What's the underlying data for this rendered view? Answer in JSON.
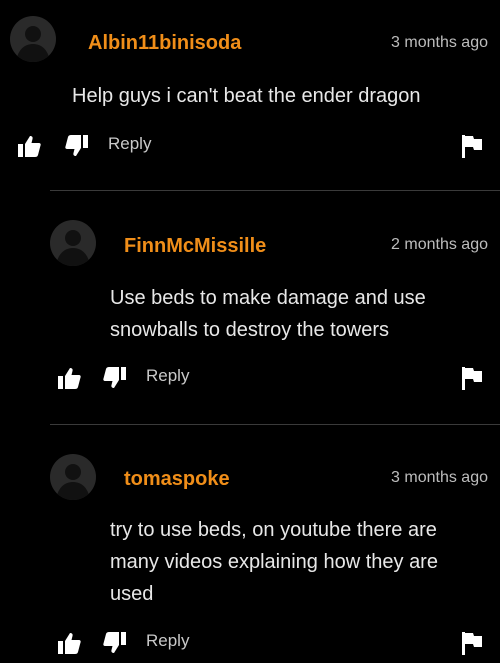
{
  "comments": [
    {
      "username": "Albin11binisoda",
      "time": "3 months ago",
      "text": "Help guys i can't beat the ender dragon",
      "reply_label": "Reply"
    },
    {
      "username": "FinnMcMissille",
      "time": "2 months ago",
      "text": "Use beds to make damage and use snowballs to destroy the towers",
      "reply_label": "Reply"
    },
    {
      "username": "tomaspoke",
      "time": "3 months ago",
      "text": "try to use beds, on youtube there are many videos explaining how they are used",
      "reply_label": "Reply"
    }
  ],
  "colors": {
    "background": "#000000",
    "username": "#f08e19",
    "text": "#e8e8e8",
    "meta": "#bdbdbd"
  },
  "icons": [
    "avatar-placeholder",
    "thumbs-up-icon",
    "thumbs-down-icon",
    "flag-icon"
  ]
}
